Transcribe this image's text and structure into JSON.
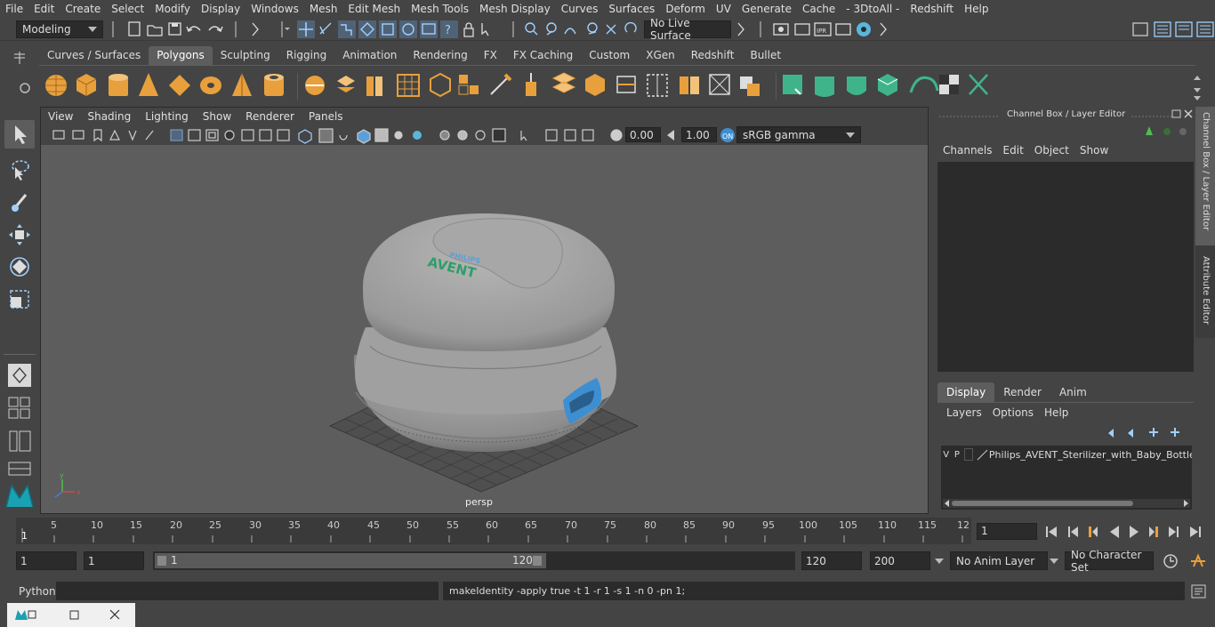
{
  "menubar": {
    "items": [
      "File",
      "Edit",
      "Create",
      "Select",
      "Modify",
      "Display",
      "Windows",
      "Mesh",
      "Edit Mesh",
      "Mesh Tools",
      "Mesh Display",
      "Curves",
      "Surfaces",
      "Deform",
      "UV",
      "Generate",
      "Cache",
      "- 3DtoAll -",
      "Redshift",
      "Help"
    ]
  },
  "statusline": {
    "mode": "Modeling",
    "live_surface": "No Live Surface"
  },
  "shelf": {
    "tabs": [
      "Curves / Surfaces",
      "Polygons",
      "Sculpting",
      "Rigging",
      "Animation",
      "Rendering",
      "FX",
      "FX Caching",
      "Custom",
      "XGen",
      "Redshift",
      "Bullet"
    ],
    "active_tab": "Polygons"
  },
  "viewport": {
    "menu": [
      "View",
      "Shading",
      "Lighting",
      "Show",
      "Renderer",
      "Panels"
    ],
    "exposure": "0.00",
    "gamma": "1.00",
    "color_space": "sRGB gamma",
    "camera_label": "persp",
    "logo_top": "PHILIPS",
    "logo_bottom": "AVENT"
  },
  "channelbox": {
    "title": "Channel Box / Layer Editor",
    "menu": [
      "Channels",
      "Edit",
      "Object",
      "Show"
    ],
    "layer_tabs": [
      "Display",
      "Render",
      "Anim"
    ],
    "active_layer_tab": "Display",
    "layer_menu": [
      "Layers",
      "Options",
      "Help"
    ],
    "layer_row": {
      "v": "V",
      "p": "P",
      "name": "Philips_AVENT_Sterilizer_with_Baby_Bottles_"
    }
  },
  "side_tabs": [
    "Channel Box / Layer Editor",
    "Attribute Editor"
  ],
  "timeline": {
    "ticks": [
      "5",
      "10",
      "15",
      "20",
      "25",
      "30",
      "35",
      "40",
      "45",
      "50",
      "55",
      "60",
      "65",
      "70",
      "75",
      "80",
      "85",
      "90",
      "95",
      "100",
      "105",
      "110",
      "115",
      "12"
    ],
    "current_frame_marker": "1",
    "current_frame_field": "1"
  },
  "range": {
    "start": "1",
    "playback_start": "1",
    "slider_start": "1",
    "slider_end": "120",
    "playback_end": "120",
    "end": "200",
    "anim_layer": "No Anim Layer",
    "character_set": "No Character Set"
  },
  "cmdline": {
    "language": "Python",
    "output": "makeIdentity -apply true -t 1 -r 1 -s 1 -n 0 -pn 1;"
  },
  "colors": {
    "accent_blue": "#5b9fd9",
    "shelf_orange": "#e8a03c",
    "shelf_green": "#3fb48a",
    "avent_green": "#2f9e6a",
    "bottle_blue": "#3d8fd1"
  }
}
